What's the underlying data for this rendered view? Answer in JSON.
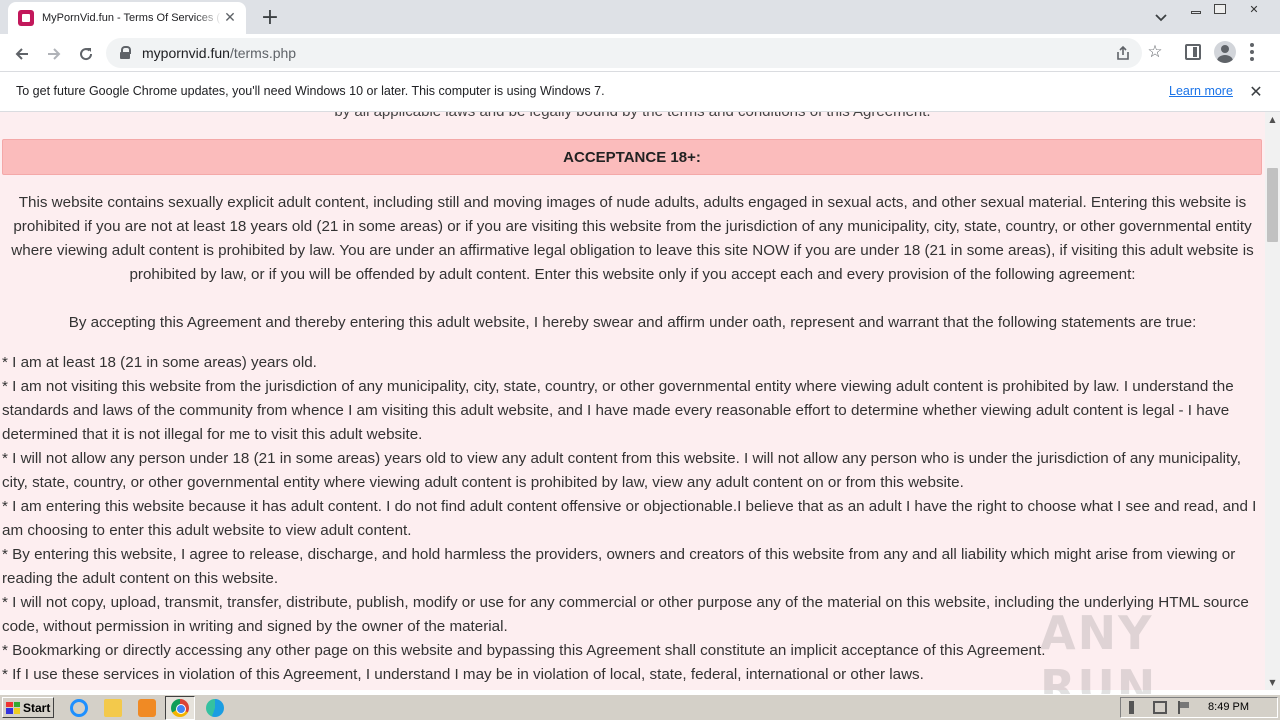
{
  "browser": {
    "tab": {
      "title": "MyPornVid.fun - Terms Of Services ("
    },
    "address": {
      "host": "mypornvid.fun",
      "path": "/terms.php"
    },
    "infobar": {
      "message": "To get future Google Chrome updates, you'll need Windows 10 or later. This computer is using Windows 7.",
      "learn_more": "Learn more"
    }
  },
  "page": {
    "cut_line": "by all applicable laws and be legally bound by the terms and conditions of this Agreement.",
    "heading": "ACCEPTANCE 18+:",
    "intro": "This website contains sexually explicit adult content, including still and moving images of nude adults, adults engaged in sexual acts, and other sexual material. Entering this website is prohibited if you are not at least 18 years old (21 in some areas) or if you are visiting this website from the jurisdiction of any municipality, city, state, country, or other governmental entity where viewing adult content is prohibited by law. You are under an affirmative legal obligation to leave this site NOW if you are under 18 (21 in some areas), if visiting this adult website is prohibited by law, or if you will be offended by adult content. Enter this website only if you accept each and every provision of the following agreement:",
    "oath": "By accepting this Agreement and thereby entering this adult website, I hereby swear and affirm under oath, represent and warrant that the following statements are true:",
    "statements": [
      "* I am at least 18 (21 in some areas) years old.",
      "* I am not visiting this website from the jurisdiction of any municipality, city, state, country, or other governmental entity where viewing adult content is prohibited by law. I understand the standards and laws of the community from whence I am visiting this adult website, and I have made every reasonable effort to determine whether viewing adult content is legal - I have determined that it is not illegal for me to visit this adult website.",
      "* I will not allow any person under 18 (21 in some areas) years old to view any adult content from this website. I will not allow any person who is under the jurisdiction of any municipality, city, state, country, or other governmental entity where viewing adult content is prohibited by law, view any adult content on or from this website.",
      "* I am entering this website because it has adult content. I do not find adult content offensive or objectionable.I believe that as an adult I have the right to choose what I see and read, and I am choosing to enter this adult website to view adult content.",
      "* By entering this website, I agree to release, discharge, and hold harmless the providers, owners and creators of this website from any and all liability which might arise from viewing or reading the adult content on this website.",
      "* I will not copy, upload, transmit, transfer, distribute, publish, modify or use for any commercial or other purpose any of the material on this website, including the underlying HTML source code, without permission in writing and signed by the owner of the material.",
      "* Bookmarking or directly accessing any other page on this website and bypassing this Agreement shall constitute an implicit acceptance of this Agreement.",
      "* If I use these services in violation of this Agreement, I understand I may be in violation of local, state, federal, international or other laws."
    ]
  },
  "watermark": "ANY RUN",
  "taskbar": {
    "start": "Start",
    "clock": "8:49 PM"
  }
}
